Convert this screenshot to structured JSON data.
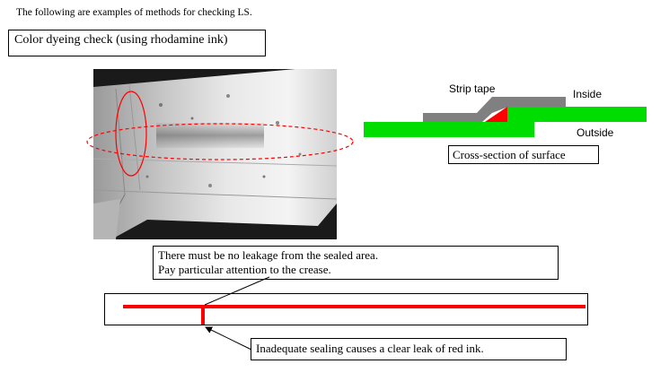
{
  "intro_text": "The following are examples of methods for checking LS.",
  "method_title": "Color dyeing check  (using rhodamine ink)",
  "cross_section": {
    "strip_tape_label": "Strip tape",
    "inside_label": "Inside",
    "outside_label": "Outside",
    "caption": "Cross-section of surface"
  },
  "note": {
    "line1": "There must be no leakage from the sealed area.",
    "line2": "Pay particular attention to the crease."
  },
  "leak_note": "Inadequate sealing causes a clear leak of red ink.",
  "colors": {
    "seal_green": "#00dd00",
    "tape_gray": "#808080",
    "ink_red": "#ff0000"
  }
}
